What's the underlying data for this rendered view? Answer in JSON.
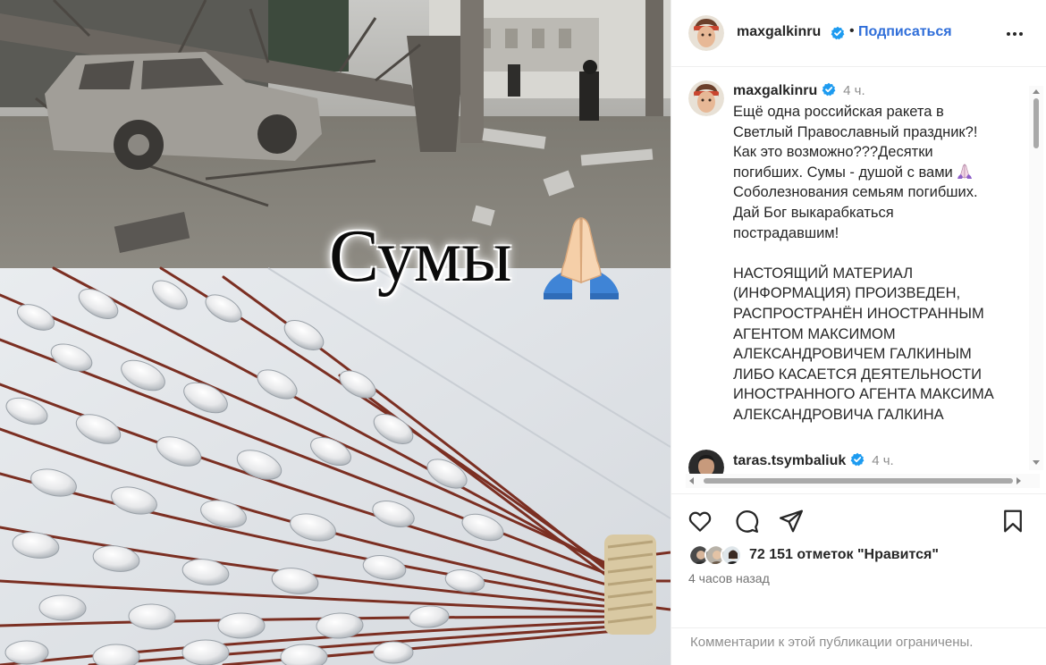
{
  "post": {
    "overlay_text": "Сумы",
    "overlay_emoji": "folded-hands"
  },
  "header": {
    "username": "maxgalkinru",
    "separator": "•",
    "follow_label": "Подписаться",
    "more_icon": "more-horizontal-icon"
  },
  "caption": {
    "username": "maxgalkinru",
    "time": "4 ч.",
    "lines": [
      "Ещё одна российская ракета в",
      "Светлый Православный праздник?!",
      "Как это возможно???Десятки",
      "погибших. Сумы - душой с вами",
      "Соболезнования семьям погибших.",
      "Дай Бог выкарабкаться",
      "пострадавшим!",
      "",
      "НАСТОЯЩИЙ МАТЕРИАЛ",
      "(ИНФОРМАЦИЯ) ПРОИЗВЕДЕН,",
      "РАСПРОСТРАНЁН ИНОСТРАННЫМ",
      "АГЕНТОМ МАКСИМОМ",
      "АЛЕКСАНДРОВИЧЕМ ГАЛКИНЫМ",
      "ЛИБО КАСАЕТСЯ ДЕЯТЕЛЬНОСТИ",
      "ИНОСТРАННОГО АГЕНТА МАКСИМА",
      "АЛЕКСАНДРОВИЧА ГАЛКИНА"
    ]
  },
  "comment": {
    "username": "taras.tsymbaliuk",
    "time": "4 ч."
  },
  "actions": {
    "like_icon": "heart-icon",
    "comment_icon": "comment-icon",
    "share_icon": "share-icon",
    "save_icon": "bookmark-icon"
  },
  "likes": {
    "count_text": "72 151 отметок \"Нравится\""
  },
  "posted_ago": "4 часов назад",
  "comments_restricted": "Комментарии к этой публикации ограничены.",
  "colors": {
    "link_blue": "#2f6ed9",
    "verified_blue": "#1d9bf0",
    "muted_gray": "#8e8e8e",
    "divider": "#efefef"
  }
}
